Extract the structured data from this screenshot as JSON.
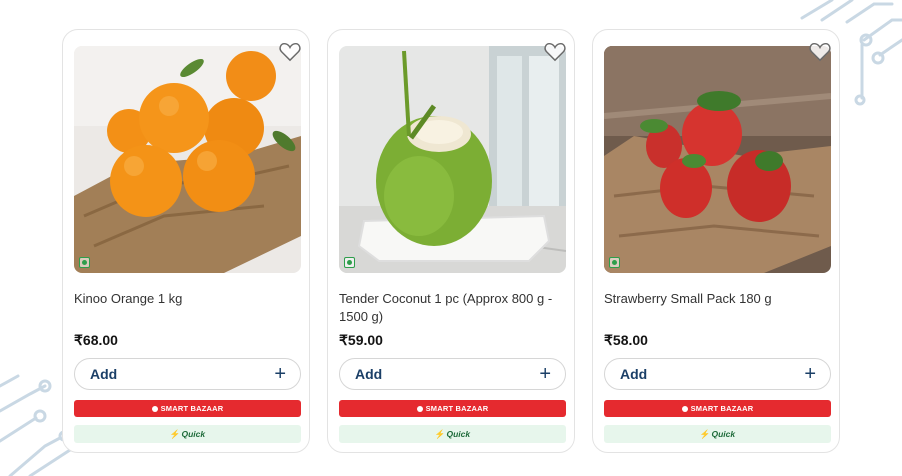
{
  "products": [
    {
      "name": "Kinoo Orange 1 kg",
      "price": "₹68.00",
      "add_label": "Add",
      "add_icon": "+",
      "store_badge": "SMART BAZAAR",
      "quick_badge": "Quick",
      "image": "oranges"
    },
    {
      "name": "Tender Coconut 1 pc (Approx 800 g - 1500 g)",
      "price": "₹59.00",
      "add_label": "Add",
      "add_icon": "+",
      "store_badge": "SMART BAZAAR",
      "quick_badge": "Quick",
      "image": "coconut"
    },
    {
      "name": "Strawberry Small Pack 180 g",
      "price": "₹58.00",
      "add_label": "Add",
      "add_icon": "+",
      "store_badge": "SMART BAZAAR",
      "quick_badge": "Quick",
      "image": "strawberries"
    }
  ],
  "colors": {
    "price": "#141414",
    "add_text": "#1b3f67",
    "smart_bazaar_red": "#e52a2f",
    "quick_green_bg": "#e7f6ec",
    "quick_green_text": "#1e6b3a"
  }
}
